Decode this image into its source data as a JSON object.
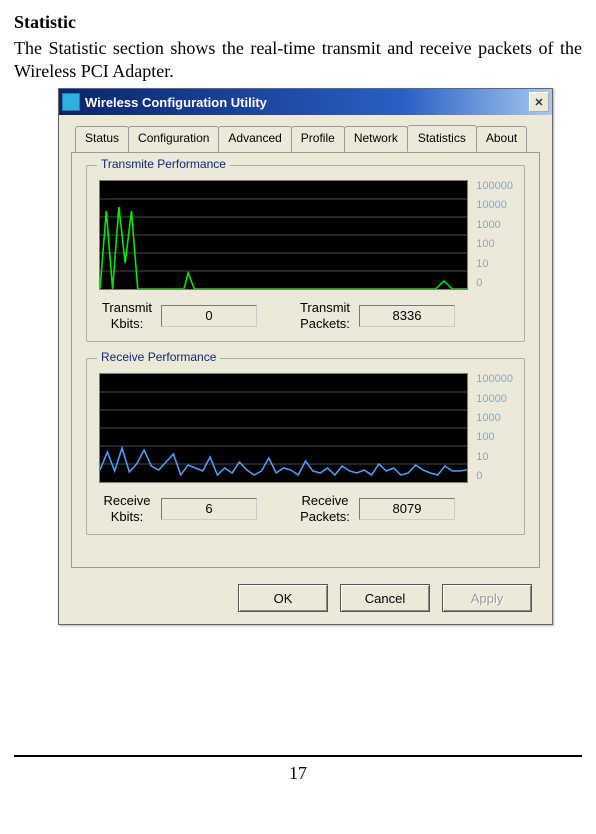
{
  "heading": "Statistic",
  "body": "The Statistic section shows the real-time transmit and receive packets of the Wireless PCI Adapter.",
  "page_number": "17",
  "dialog": {
    "title": "Wireless Configuration Utility",
    "tabs": {
      "status": "Status",
      "configuration": "Configuration",
      "advanced": "Advanced",
      "profile": "Profile",
      "network": "Network",
      "statistics": "Statistics",
      "about": "About"
    },
    "transmit": {
      "group_title": "Transmite Performance",
      "kbits_label_1": "Transmit",
      "kbits_label_2": "Kbits:",
      "kbits_value": "0",
      "packets_label_1": "Transmit",
      "packets_label_2": "Packets:",
      "packets_value": "8336"
    },
    "receive": {
      "group_title": "Receive Performance",
      "kbits_label_1": "Receive",
      "kbits_label_2": "Kbits:",
      "kbits_value": "6",
      "packets_label_1": "Receive",
      "packets_label_2": "Packets:",
      "packets_value": "8079"
    },
    "ylabels": {
      "y0": "100000",
      "y1": "10000",
      "y2": "1000",
      "y3": "100",
      "y4": "10",
      "y5": "0"
    },
    "buttons": {
      "ok": "OK",
      "cancel": "Cancel",
      "apply": "Apply"
    }
  },
  "chart_data": [
    {
      "type": "line",
      "title": "Transmite Performance",
      "xlabel": "",
      "ylabel": "Kbits",
      "ylim": [
        0,
        100000
      ],
      "y_ticks": [
        0,
        10,
        100,
        1000,
        10000,
        100000
      ],
      "series": [
        {
          "name": "Transmit Kbits",
          "color": "#00ff00",
          "values": [
            0,
            800,
            0,
            1200,
            50,
            800,
            0,
            0,
            0,
            0,
            0,
            0,
            15,
            0,
            0,
            0,
            0,
            0,
            0,
            0,
            0,
            0,
            0,
            0,
            0,
            0,
            0,
            0,
            0,
            0,
            0,
            0,
            0,
            0,
            0,
            0,
            0,
            0,
            0,
            0,
            0,
            0,
            0,
            0,
            0,
            0,
            0,
            5,
            0
          ]
        }
      ]
    },
    {
      "type": "line",
      "title": "Receive Performance",
      "xlabel": "",
      "ylabel": "Kbits",
      "ylim": [
        0,
        100000
      ],
      "y_ticks": [
        0,
        10,
        100,
        1000,
        10000,
        100000
      ],
      "series": [
        {
          "name": "Receive Kbits",
          "color": "#4aa0ff",
          "values": [
            8,
            35,
            7,
            45,
            6,
            12,
            42,
            10,
            8,
            14,
            30,
            5,
            11,
            9,
            7,
            22,
            5,
            9,
            6,
            14,
            8,
            5,
            7,
            20,
            6,
            9,
            8,
            5,
            15,
            7,
            6,
            9,
            5,
            10,
            7,
            6,
            8,
            5,
            12,
            7,
            9,
            5,
            6,
            11,
            8,
            6,
            5,
            10,
            7
          ]
        }
      ]
    }
  ]
}
